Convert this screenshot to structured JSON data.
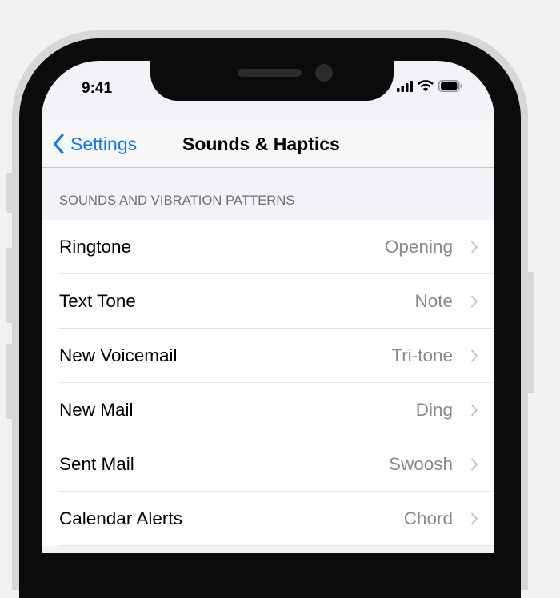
{
  "status_bar": {
    "time": "9:41"
  },
  "nav": {
    "back_label": "Settings",
    "title": "Sounds & Haptics"
  },
  "section": {
    "header": "SOUNDS AND VIBRATION PATTERNS",
    "rows": [
      {
        "label": "Ringtone",
        "value": "Opening"
      },
      {
        "label": "Text Tone",
        "value": "Note"
      },
      {
        "label": "New Voicemail",
        "value": "Tri-tone"
      },
      {
        "label": "New Mail",
        "value": "Ding"
      },
      {
        "label": "Sent Mail",
        "value": "Swoosh"
      },
      {
        "label": "Calendar Alerts",
        "value": "Chord"
      }
    ]
  },
  "icons": [
    "chevron-left-icon",
    "cellular-signal-icon",
    "wifi-icon",
    "battery-icon",
    "chevron-right-icon"
  ],
  "colors": {
    "accent": "#0a7aff",
    "value_text": "#8a8a8e",
    "background": "#f2f2f7"
  }
}
